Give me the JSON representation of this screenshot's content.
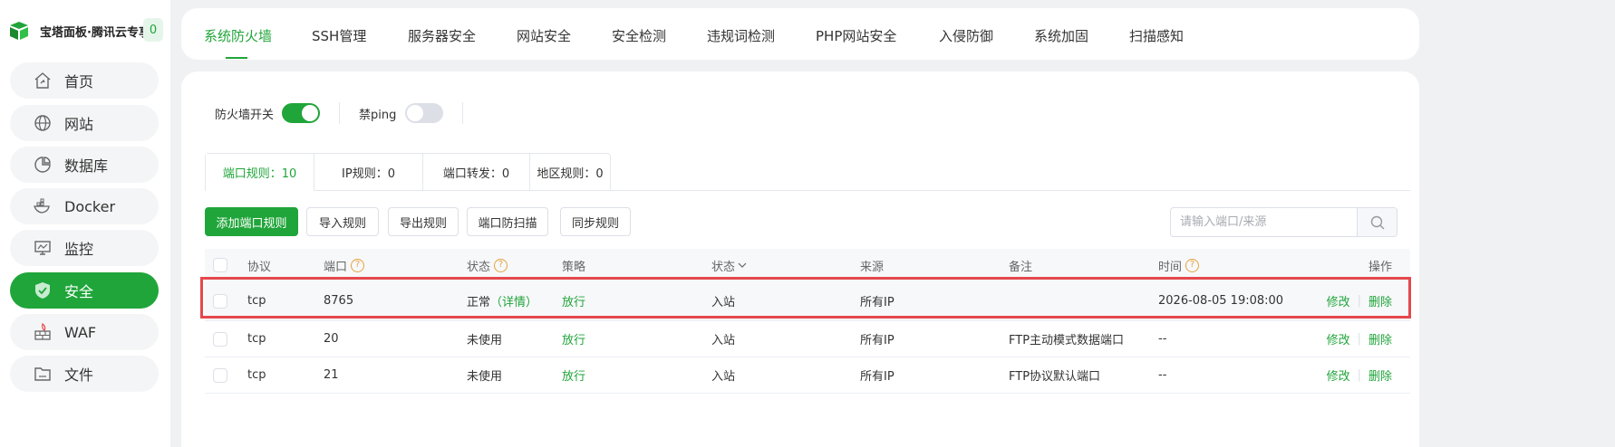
{
  "sidebar": {
    "brand_title": "宝塔面板·腾讯云专享版",
    "brand_badge": "0",
    "items": [
      {
        "label": "首页",
        "icon": "home-icon"
      },
      {
        "label": "网站",
        "icon": "globe-icon"
      },
      {
        "label": "数据库",
        "icon": "database-icon"
      },
      {
        "label": "Docker",
        "icon": "docker-icon"
      },
      {
        "label": "监控",
        "icon": "monitor-icon"
      },
      {
        "label": "安全",
        "icon": "shield-icon",
        "active": true
      },
      {
        "label": "WAF",
        "icon": "firewall-icon"
      },
      {
        "label": "文件",
        "icon": "folder-icon"
      }
    ]
  },
  "top_tabs": [
    {
      "label": "系统防火墙",
      "active": true
    },
    {
      "label": "SSH管理"
    },
    {
      "label": "服务器安全"
    },
    {
      "label": "网站安全"
    },
    {
      "label": "安全检测"
    },
    {
      "label": "违规词检测"
    },
    {
      "label": "PHP网站安全"
    },
    {
      "label": "入侵防御"
    },
    {
      "label": "系统加固"
    },
    {
      "label": "扫描感知"
    }
  ],
  "switches": {
    "firewall_label": "防火墙开关",
    "firewall_on": true,
    "ping_label": "禁ping",
    "ping_on": false
  },
  "sub_tabs": [
    {
      "label": "端口规则：10",
      "active": true
    },
    {
      "label": "IP规则：0"
    },
    {
      "label": "端口转发：0"
    },
    {
      "label": "地区规则：0"
    }
  ],
  "toolbar": {
    "add": "添加端口规则",
    "import": "导入规则",
    "export": "导出规则",
    "scan": "端口防扫描",
    "sync": "同步规则",
    "search_placeholder": "请输入端口/来源"
  },
  "table": {
    "headers": {
      "protocol": "协议",
      "port": "端口",
      "status": "状态",
      "policy": "策略",
      "direction": "状态",
      "source": "来源",
      "note": "备注",
      "time": "时间",
      "ops": "操作"
    },
    "rows": [
      {
        "protocol": "tcp",
        "port": "8765",
        "status": "正常",
        "detail": "（详情）",
        "policy": "放行",
        "direction": "入站",
        "source": "所有IP",
        "note": "",
        "time": "2026-08-05 19:08:00",
        "edit": "修改",
        "delete": "删除"
      },
      {
        "protocol": "tcp",
        "port": "20",
        "status": "未使用",
        "detail": "",
        "policy": "放行",
        "direction": "入站",
        "source": "所有IP",
        "note": "FTP主动模式数据端口",
        "time": "--",
        "edit": "修改",
        "delete": "删除"
      },
      {
        "protocol": "tcp",
        "port": "21",
        "status": "未使用",
        "detail": "",
        "policy": "放行",
        "direction": "入站",
        "source": "所有IP",
        "note": "FTP协议默认端口",
        "time": "--",
        "edit": "修改",
        "delete": "删除"
      }
    ]
  },
  "colors": {
    "accent": "#20a53a",
    "highlight": "#e5484d",
    "help": "#e6a23c"
  }
}
